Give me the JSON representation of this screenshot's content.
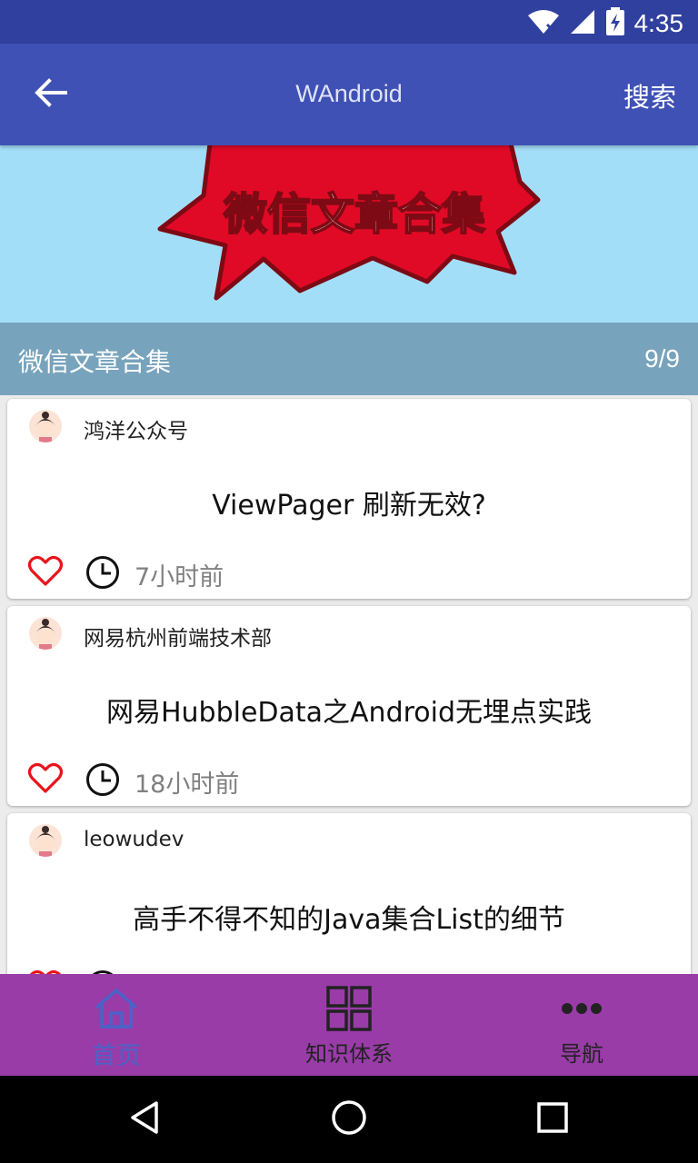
{
  "status_bar": {
    "time": "4:35",
    "icons": [
      "wifi-icon",
      "signal-icon",
      "battery-charging-icon"
    ]
  },
  "app_bar": {
    "back_icon": "arrow-left-icon",
    "title": "WAndroid",
    "search_label": "搜索"
  },
  "banner": {
    "title": "微信文章合集",
    "page_indicator": "9/9",
    "art_text": "微信文章合集"
  },
  "articles": [
    {
      "author": "鸿洋公众号",
      "title": "ViewPager 刷新无效?",
      "time": "7小时前"
    },
    {
      "author": "网易杭州前端技术部",
      "title": "网易HubbleData之Android无埋点实践",
      "time": "18小时前"
    },
    {
      "author": "leowudev",
      "title": "高手不得不知的Java集合List的细节",
      "time": ""
    }
  ],
  "bottom_nav": {
    "items": [
      {
        "label": "首页",
        "icon": "home-icon",
        "active": true
      },
      {
        "label": "知识体系",
        "icon": "grid-icon",
        "active": false
      },
      {
        "label": "导航",
        "icon": "more-dots-icon",
        "active": false
      }
    ]
  },
  "colors": {
    "status_bar": "#30409e",
    "app_bar": "#3f51b5",
    "banner_bg": "#a3def9",
    "caption_bg": "#78a3bc",
    "bottom_nav": "#993ca8",
    "active_nav": "#4a63c8",
    "heart": "#e8141c"
  }
}
